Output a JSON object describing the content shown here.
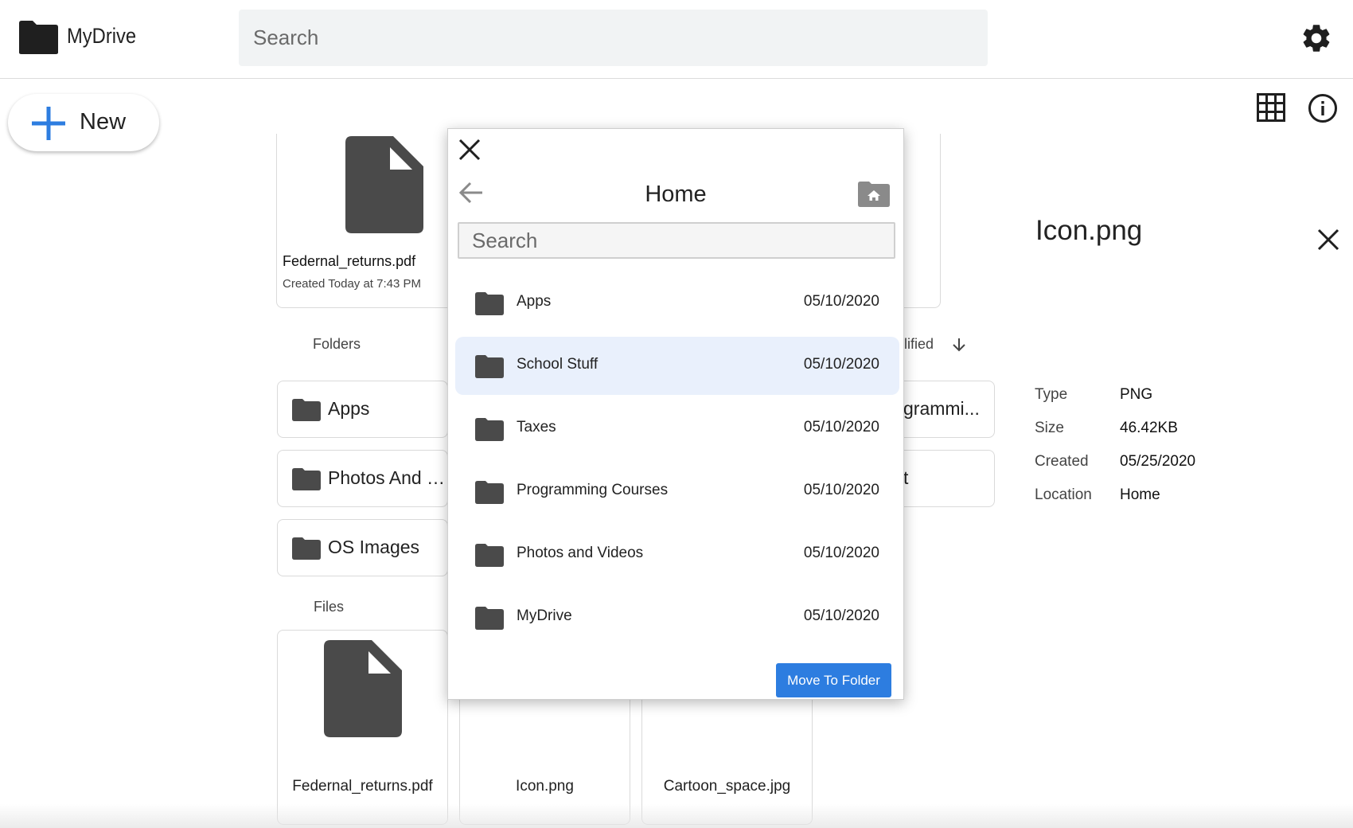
{
  "app": {
    "title": "MyDrive"
  },
  "search": {
    "placeholder": "Search"
  },
  "toolbar": {
    "new_label": "New"
  },
  "top_file": {
    "name": "Federnal_returns.pdf",
    "created": "Created Today at 7:43 PM"
  },
  "sections": {
    "folders": "Folders",
    "files": "Files",
    "sort_label": "lified"
  },
  "folders": [
    {
      "label": "Apps"
    },
    {
      "label": "Photos And Videos"
    },
    {
      "label": "OS Images"
    },
    {
      "label": "grammi..."
    },
    {
      "label": "t"
    }
  ],
  "files": [
    {
      "name": "Federnal_returns.pdf"
    },
    {
      "name": "Icon.png"
    },
    {
      "name": "Cartoon_space.jpg"
    }
  ],
  "details": {
    "title": "Icon.png",
    "rows": [
      {
        "key": "Type",
        "value": "PNG"
      },
      {
        "key": "Size",
        "value": "46.42KB"
      },
      {
        "key": "Created",
        "value": "05/25/2020"
      },
      {
        "key": "Location",
        "value": "Home"
      }
    ]
  },
  "modal": {
    "title": "Home",
    "search_placeholder": "Search",
    "items": [
      {
        "name": "Apps",
        "date": "05/10/2020",
        "selected": false
      },
      {
        "name": "School Stuff",
        "date": "05/10/2020",
        "selected": true
      },
      {
        "name": "Taxes",
        "date": "05/10/2020",
        "selected": false
      },
      {
        "name": "Programming Courses",
        "date": "05/10/2020",
        "selected": false
      },
      {
        "name": "Photos and Videos",
        "date": "05/10/2020",
        "selected": false
      },
      {
        "name": "MyDrive",
        "date": "05/10/2020",
        "selected": false
      }
    ],
    "move_label": "Move To Folder"
  },
  "colors": {
    "accent": "#2d7de0",
    "selected_row": "#e9f0fc",
    "icon_dark": "#4a4a4a"
  },
  "icons": [
    "folder-icon",
    "search-icon",
    "gear-icon",
    "plus-icon",
    "grid-icon",
    "info-icon",
    "close-icon",
    "back-arrow-icon",
    "home-folder-icon",
    "document-icon",
    "arrow-down-icon"
  ]
}
